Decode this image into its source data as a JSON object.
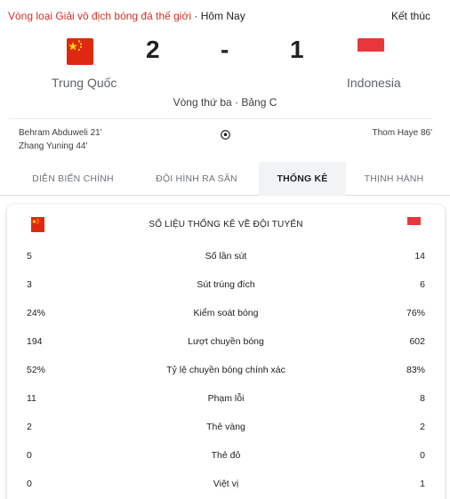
{
  "header": {
    "competition": "Vòng loại Giải vô địch bóng đá thế giới",
    "separator": " · ",
    "date": "Hôm Nay",
    "status": "Kết thúc"
  },
  "match": {
    "home_team": "Trung Quốc",
    "away_team": "Indonesia",
    "home_score": "2",
    "away_score": "1",
    "dash": "-",
    "round": "Vòng thứ ba · Bảng C",
    "home_scorers": [
      "Behram Abduweli 21'",
      "Zhang Yuning 44'"
    ],
    "away_scorers": [
      "Thom Haye 86'"
    ]
  },
  "tabs": [
    {
      "label": "DIỄN BIẾN CHÍNH",
      "active": false
    },
    {
      "label": "ĐỘI HÌNH RA SÂN",
      "active": false
    },
    {
      "label": "THỐNG KÊ",
      "active": true
    },
    {
      "label": "THỊNH HÀNH",
      "active": false
    }
  ],
  "stats": {
    "title": "SỐ LIỆU THỐNG KÊ VỀ ĐỘI TUYỂN",
    "rows": [
      {
        "home": "5",
        "label": "Số lần sút",
        "away": "14"
      },
      {
        "home": "3",
        "label": "Sút trúng đích",
        "away": "6"
      },
      {
        "home": "24%",
        "label": "Kiểm soát bóng",
        "away": "76%"
      },
      {
        "home": "194",
        "label": "Lượt chuyền bóng",
        "away": "602"
      },
      {
        "home": "52%",
        "label": "Tỷ lệ chuyền bóng chính xác",
        "away": "83%"
      },
      {
        "home": "11",
        "label": "Phạm lỗi",
        "away": "8"
      },
      {
        "home": "2",
        "label": "Thẻ vàng",
        "away": "2"
      },
      {
        "home": "0",
        "label": "Thẻ đỏ",
        "away": "0"
      },
      {
        "home": "0",
        "label": "Việt vị",
        "away": "1"
      }
    ]
  },
  "icons": {
    "home_flag": "china-flag-icon",
    "away_flag": "indonesia-flag-icon",
    "goal": "soccer-ball-icon"
  },
  "colors": {
    "competition_link": "#d93025",
    "china_red": "#de2910",
    "china_star": "#ffde00",
    "indonesia_red": "#e8373c",
    "active_tab_bg": "#f1f3f4"
  }
}
